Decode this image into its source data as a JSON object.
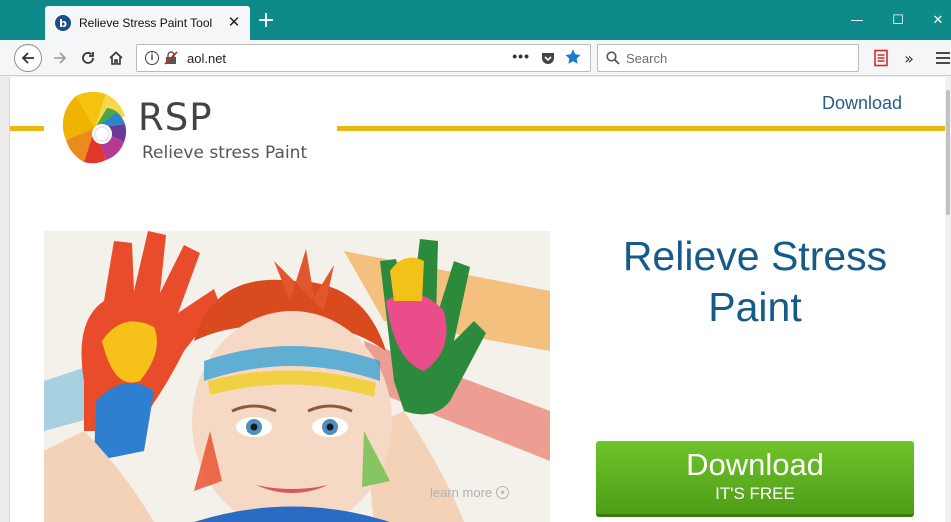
{
  "browser": {
    "tab_title": "Relieve Stress Paint Tool",
    "tab_favicon": "b",
    "tab_close": "✕",
    "new_tab": "+",
    "window_controls": {
      "minimize": "—",
      "maximize": "☐",
      "close": "✕"
    },
    "url": "aol.net",
    "url_actions_dots": "•••",
    "search_placeholder": "Search",
    "overflow": "»",
    "colors": {
      "titlebar": "#0f8a8a",
      "bookmark_star": "#1a7bd6",
      "reader_icon": "#d12c2c"
    }
  },
  "page": {
    "logo_title": "RSP",
    "logo_subtitle": "Relieve stress Paint",
    "nav_download": "Download",
    "headline": "Relieve Stress Paint",
    "learn_more": "learn more",
    "learn_more_icon": "▾",
    "cta_main": "Download",
    "cta_sub": "IT'S FREE",
    "colors": {
      "accent_line": "#e8b814",
      "headline": "#165a8a",
      "cta": "#5aad1f"
    }
  }
}
